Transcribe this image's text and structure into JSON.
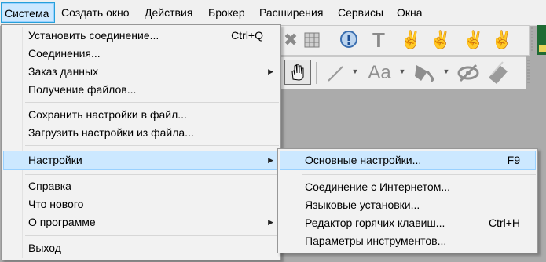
{
  "menubar": {
    "items": [
      {
        "label": "Система"
      },
      {
        "label": "Создать окно"
      },
      {
        "label": "Действия"
      },
      {
        "label": "Брокер"
      },
      {
        "label": "Расширения"
      },
      {
        "label": "Сервисы"
      },
      {
        "label": "Окна"
      }
    ]
  },
  "system_menu": {
    "items": [
      {
        "label": "Установить соединение...",
        "shortcut": "Ctrl+Q"
      },
      {
        "label": "Соединения..."
      },
      {
        "label": "Заказ данных",
        "submenu_arrow": "▶"
      },
      {
        "label": "Получение файлов..."
      },
      {
        "label": "Сохранить настройки в файл..."
      },
      {
        "label": "Загрузить настройки из файла..."
      },
      {
        "label": "Настройки",
        "submenu_arrow": "▶"
      },
      {
        "label": "Справка"
      },
      {
        "label": "Что нового"
      },
      {
        "label": "О программе",
        "submenu_arrow": "▶"
      },
      {
        "label": "Выход"
      }
    ]
  },
  "settings_submenu": {
    "items": [
      {
        "label": "Основные настройки...",
        "shortcut": "F9"
      },
      {
        "label": "Соединение с Интернетом..."
      },
      {
        "label": "Языковые установки..."
      },
      {
        "label": "Редактор горячих клавиш...",
        "shortcut": "Ctrl+H"
      },
      {
        "label": "Параметры инструментов..."
      }
    ]
  },
  "toolbar_icons": {
    "font_label": "Aa",
    "text_tool": "T"
  },
  "colors": {
    "menu_highlight": "#cce8ff",
    "menu_highlight_border": "#99d1ff",
    "active_menubar_border": "#26a0da",
    "workspace_bg": "#ababab"
  }
}
